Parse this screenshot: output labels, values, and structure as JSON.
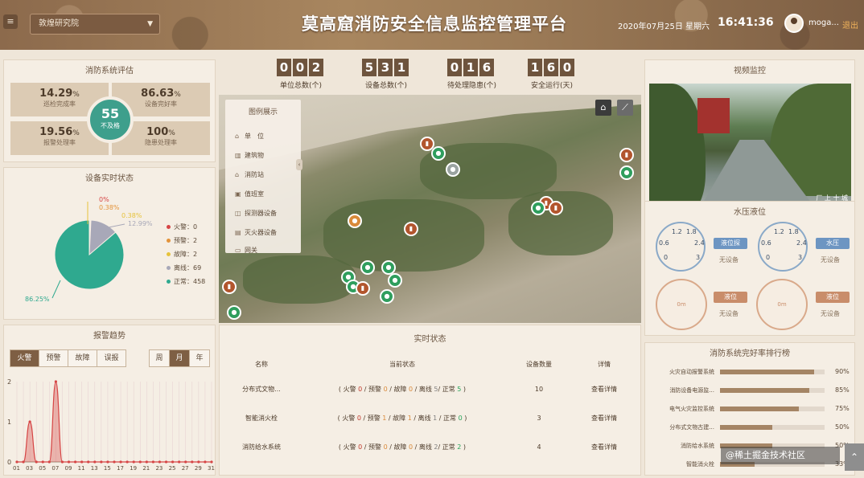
{
  "header": {
    "menu_icon": "menu-icon",
    "selector_value": "敦煌研究院",
    "title": "莫高窟消防安全信息监控管理平台",
    "date": "2020年07月25日",
    "weekday": "星期六",
    "time": "16:41:36",
    "username": "moga...",
    "logout": "退出"
  },
  "evaluation": {
    "title": "消防系统评估",
    "items": [
      {
        "value": "14.29",
        "unit": "%",
        "label": "巡检完成率"
      },
      {
        "value": "86.63",
        "unit": "%",
        "label": "设备完好率"
      },
      {
        "value": "19.56",
        "unit": "%",
        "label": "报警处理率"
      },
      {
        "value": "100",
        "unit": "%",
        "label": "隐患处理率"
      }
    ],
    "score": "55",
    "score_label": "不及格"
  },
  "device_status": {
    "title": "设备实时状态",
    "pie_labels": [
      "0%",
      "0.38%",
      "0.38%",
      "12.99%",
      "86.25%"
    ],
    "legend": [
      {
        "label": "火警",
        "count": "0",
        "color": "#d64545"
      },
      {
        "label": "预警",
        "count": "2",
        "color": "#e3933a"
      },
      {
        "label": "故障",
        "count": "2",
        "color": "#e6c23a"
      },
      {
        "label": "离线",
        "count": "69",
        "color": "#a8a8b8"
      },
      {
        "label": "正常",
        "count": "458",
        "color": "#2fa98f"
      }
    ],
    "chart_data": {
      "type": "pie",
      "categories": [
        "火警",
        "预警",
        "故障",
        "离线",
        "正常"
      ],
      "values": [
        0,
        0.38,
        0.38,
        12.99,
        86.25
      ]
    }
  },
  "alarm_trend": {
    "title": "报警趋势",
    "type_tabs": [
      "火警",
      "预警",
      "故障",
      "误报"
    ],
    "period_tabs": [
      "周",
      "月",
      "年"
    ],
    "y_ticks": [
      "0",
      "1",
      "2"
    ],
    "x_ticks": [
      "01",
      "03",
      "05",
      "07",
      "09",
      "11",
      "13",
      "15",
      "17",
      "19",
      "21",
      "23",
      "25",
      "27",
      "29",
      "31"
    ],
    "chart_data": {
      "type": "area",
      "x": [
        "01",
        "02",
        "03",
        "04",
        "05",
        "06",
        "07",
        "08",
        "09",
        "10",
        "11",
        "12",
        "13",
        "14",
        "15",
        "16",
        "17",
        "18",
        "19",
        "20",
        "21",
        "22",
        "23",
        "24",
        "25",
        "26",
        "27",
        "28",
        "29",
        "30",
        "31"
      ],
      "series": [
        {
          "values": [
            0,
            0,
            1,
            0,
            0,
            0,
            2,
            0,
            0,
            0,
            0,
            0,
            0,
            0,
            0,
            0,
            0,
            0,
            0,
            0,
            0,
            0,
            0,
            0,
            0,
            0,
            0,
            0,
            0,
            0,
            0
          ]
        }
      ],
      "ylim": [
        0,
        2
      ]
    }
  },
  "counters": [
    {
      "digits": [
        "0",
        "0",
        "2"
      ],
      "label": "单位总数(个)"
    },
    {
      "digits": [
        "5",
        "3",
        "1"
      ],
      "label": "设备总数(个)"
    },
    {
      "digits": [
        "0",
        "1",
        "6"
      ],
      "label": "待处理隐患(个)"
    },
    {
      "digits": [
        "1",
        "6",
        "0"
      ],
      "label": "安全运行(天)"
    }
  ],
  "map": {
    "legend_title": "图例展示",
    "legend_items": [
      {
        "icon": "home-icon",
        "label": "单　位"
      },
      {
        "icon": "building-icon",
        "label": "建筑物"
      },
      {
        "icon": "fire-station-icon",
        "label": "消防站"
      },
      {
        "icon": "warehouse-icon",
        "label": "值班室"
      },
      {
        "icon": "detector-icon",
        "label": "探测器设备"
      },
      {
        "icon": "extinguisher-icon",
        "label": "灭火器设备"
      },
      {
        "icon": "gateway-icon",
        "label": "网关"
      }
    ]
  },
  "realtime": {
    "title": "实时状态",
    "columns": [
      "名称",
      "当前状态",
      "设备数量",
      "详情"
    ],
    "rows": [
      {
        "name": "分布式文物...",
        "fire": "0",
        "warn": "0",
        "fault": "0",
        "offline": "5",
        "normal": "5",
        "count": "10",
        "detail": "查看详情"
      },
      {
        "name": "智能消火栓",
        "fire": "0",
        "warn": "1",
        "fault": "1",
        "offline": "1",
        "normal": "0",
        "count": "3",
        "detail": "查看详情"
      },
      {
        "name": "消防给水系统",
        "fire": "0",
        "warn": "0",
        "fault": "0",
        "offline": "2",
        "normal": "2",
        "count": "4",
        "detail": "查看详情"
      }
    ],
    "status_labels": {
      "fire": "火警",
      "warn": "预警",
      "fault": "故障",
      "offline": "离线",
      "normal": "正常"
    }
  },
  "video": {
    "title": "视频监控",
    "overlay": "厂 上 十 城"
  },
  "water": {
    "title": "水压液位",
    "gauges": [
      {
        "ticks": [
          "0.6",
          "1.2",
          "1.8",
          "2.4",
          "0",
          "3"
        ],
        "button": "液位探",
        "status": "无设备"
      },
      {
        "ticks": [
          "0.6",
          "1.2",
          "1.8",
          "2.4",
          "0",
          "3"
        ],
        "button": "水压",
        "status": "无设备"
      }
    ],
    "rings": [
      {
        "value": "0m",
        "button": "液位",
        "status": "无设备"
      },
      {
        "value": "0m",
        "button": "液位",
        "status": "无设备"
      }
    ]
  },
  "ranking": {
    "title": "消防系统完好率排行榜",
    "items": [
      {
        "label": "火灾自动报警系统",
        "percent": 90
      },
      {
        "label": "消防设备电源监...",
        "percent": 85
      },
      {
        "label": "电气火灾监控系统",
        "percent": 75
      },
      {
        "label": "分布式文物古建...",
        "percent": 50
      },
      {
        "label": "消防给水系统",
        "percent": 50
      },
      {
        "label": "智能消火栓",
        "percent": 33
      }
    ],
    "percent_labels": [
      "90%",
      "85%",
      "75%",
      "50%",
      "50%",
      "33%"
    ]
  },
  "watermark": "@稀土掘金技术社区"
}
